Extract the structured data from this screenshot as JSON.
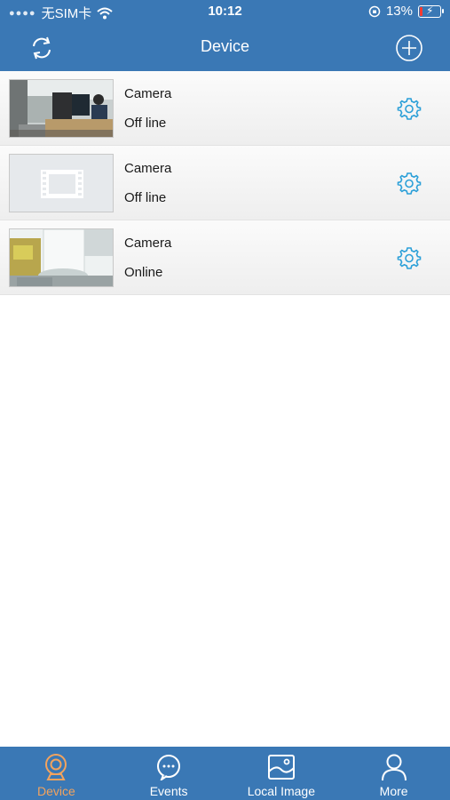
{
  "status_bar": {
    "carrier": "无SIM卡",
    "time": "10:12",
    "battery": "13%",
    "battery_level": 0.13
  },
  "nav": {
    "title": "Device",
    "left_icon": "refresh-icon",
    "right_icon": "add-icon"
  },
  "devices": [
    {
      "name": "Camera",
      "status": "Off line",
      "thumb": "office-scene"
    },
    {
      "name": "Camera",
      "status": "Off line",
      "thumb": "video-placeholder"
    },
    {
      "name": "Camera",
      "status": "Online",
      "thumb": "glass-scene"
    }
  ],
  "tabs": [
    {
      "label": "Device",
      "icon": "camera-icon",
      "active": true
    },
    {
      "label": "Events",
      "icon": "chat-bubble-icon",
      "active": false
    },
    {
      "label": "Local Image",
      "icon": "image-icon",
      "active": false
    },
    {
      "label": "More",
      "icon": "person-icon",
      "active": false
    }
  ],
  "colors": {
    "primary": "#3a78b5",
    "active_tab": "#f2a35e",
    "gear": "#2a9fd8"
  }
}
